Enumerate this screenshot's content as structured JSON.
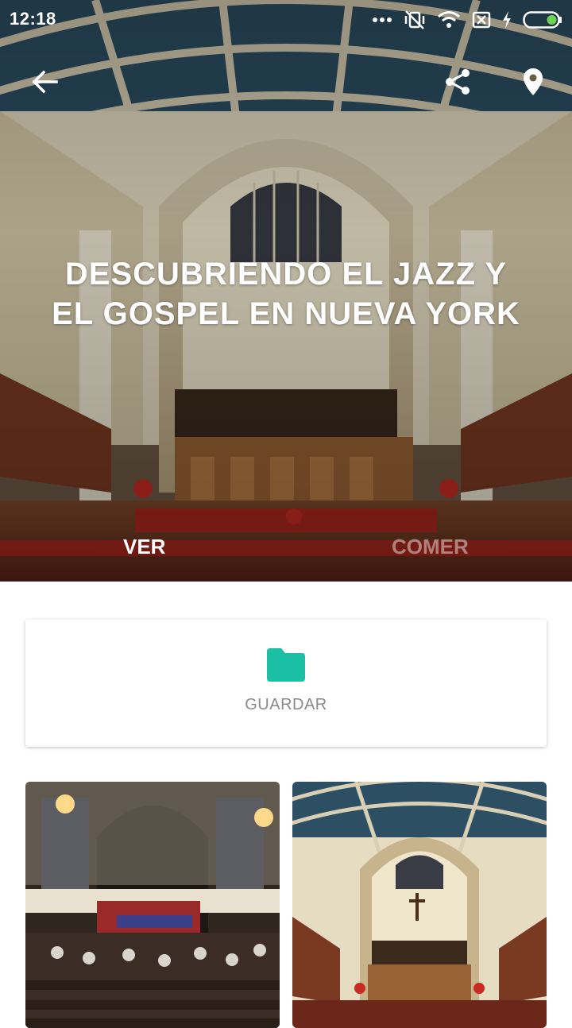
{
  "status_bar": {
    "time": "12:18",
    "icons": [
      "dots-icon",
      "vibrate-off-icon",
      "wifi-icon",
      "no-sim-icon",
      "charging-icon",
      "battery-icon"
    ]
  },
  "toolbar": {
    "back_icon": "arrow-left-icon",
    "share_icon": "share-icon",
    "map_icon": "map-pin-icon"
  },
  "hero": {
    "title": "DESCUBRIENDO EL JAZZ Y EL GOSPEL EN NUEVA YORK",
    "image": "church-interior-photo"
  },
  "tabs": [
    {
      "label": "VER",
      "active": true
    },
    {
      "label": "COMER",
      "active": false
    }
  ],
  "save_card": {
    "icon": "folder-icon",
    "label": "GUARDAR",
    "icon_color": "#1bbfa3"
  },
  "gallery": [
    {
      "image": "church-service-photo"
    },
    {
      "image": "church-interior-photo"
    }
  ],
  "colors": {
    "accent": "#1bbfa3",
    "battery": "#6fd35a",
    "inactive_tab": "rgba(255,255,255,0.45)"
  }
}
